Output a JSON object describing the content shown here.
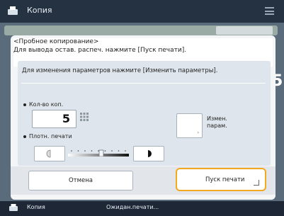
{
  "header": {
    "title": "Копия"
  },
  "background": {
    "right_digit": "5"
  },
  "dialog": {
    "title": "<Пробное копирование>",
    "message": "Для вывода остав. распеч. нажмите [Пуск печати].",
    "hint": "Для изменения параметров нажмите [Изменить параметры].",
    "copies_label": "Кол-во коп.",
    "copies_value": "5",
    "density_label": "Плотн. печати",
    "density_level": 0.55,
    "change_params_label_line1": "Измен.",
    "change_params_label_line2": "парам.",
    "cancel_label": "Отмена",
    "start_label": "Пуск печати"
  },
  "status_bar": {
    "app": "Копия",
    "status": "Ожидан.печати..."
  },
  "colors": {
    "accent": "#f3a81f",
    "panel": "#dfe5ec",
    "topbar": "#243241"
  }
}
